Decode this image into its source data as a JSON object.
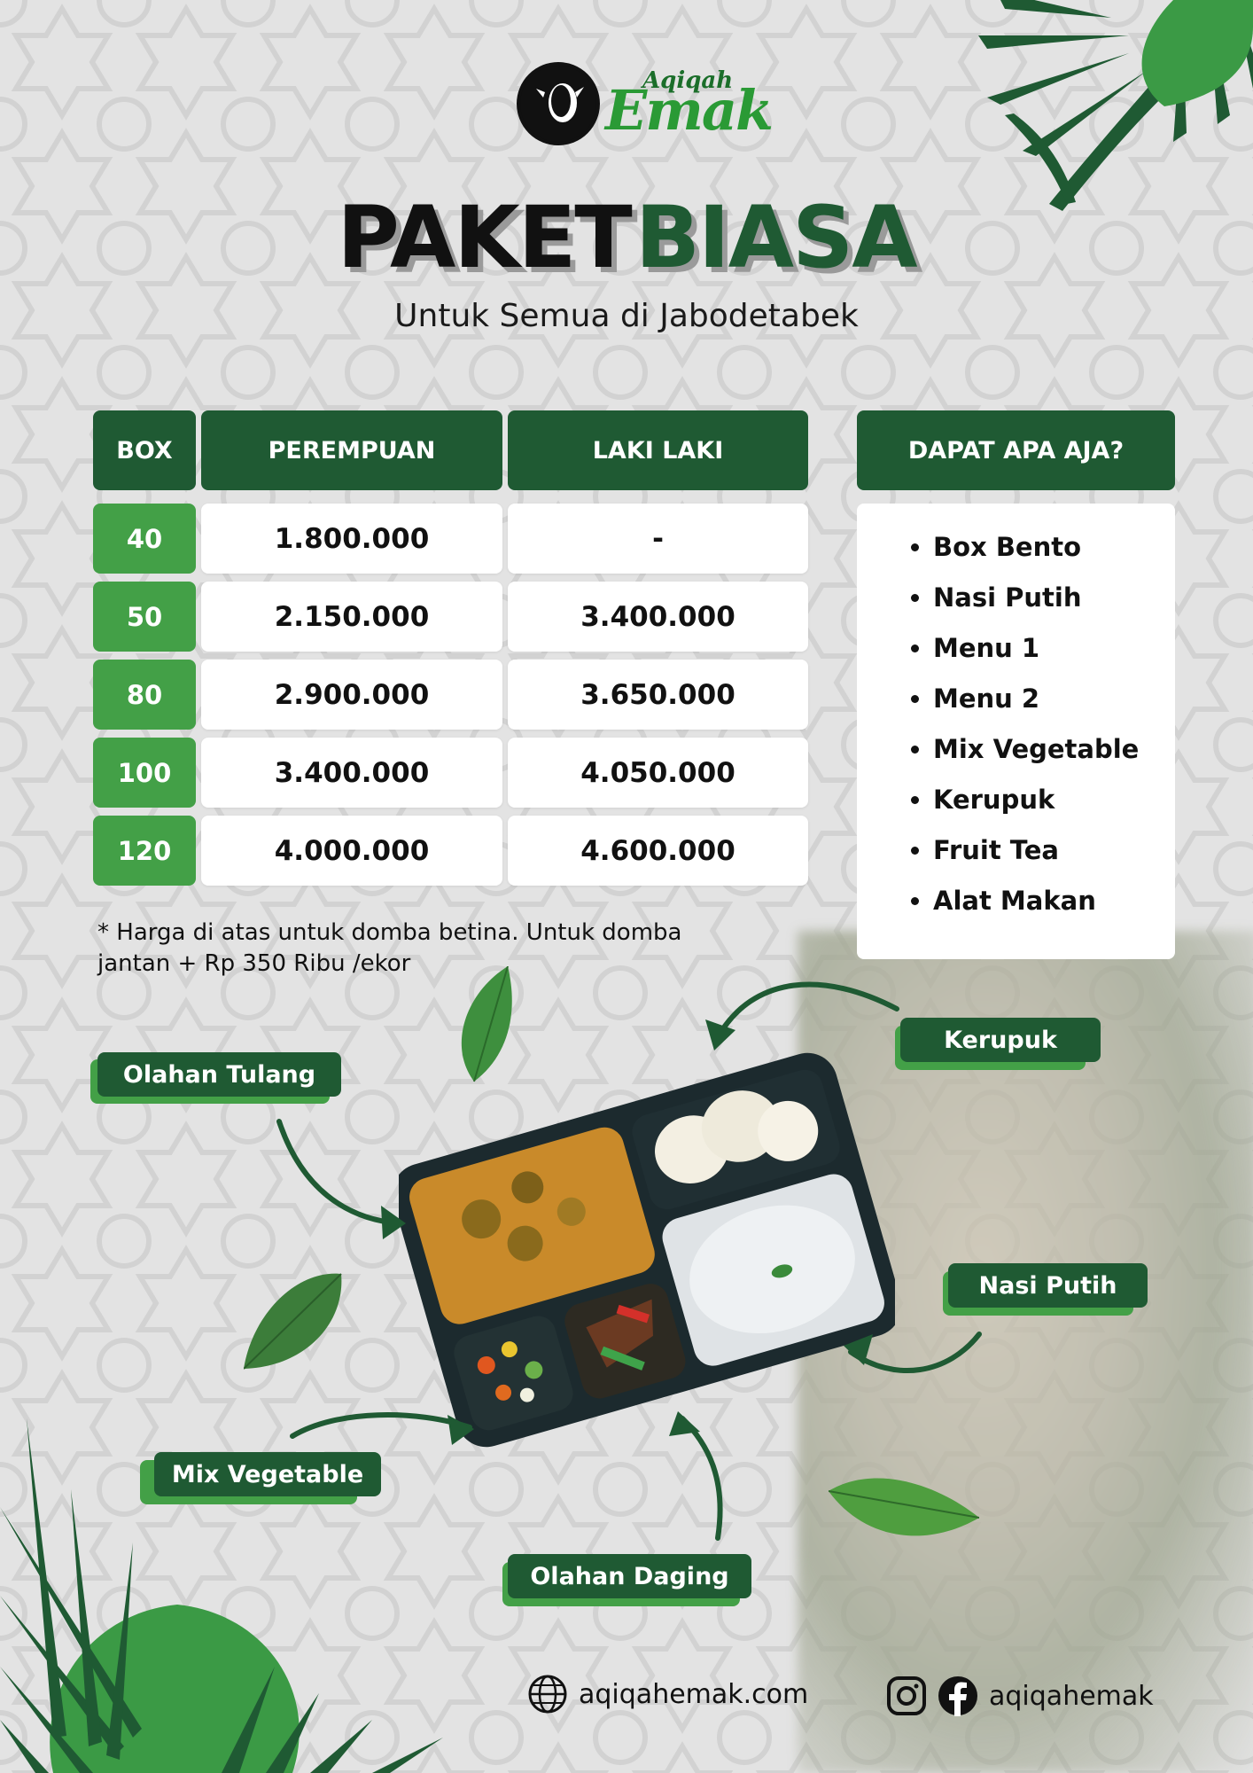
{
  "brand": {
    "line1": "Aqiqah",
    "line2": "Emak"
  },
  "title": {
    "word1": "PAKET",
    "word2": "BIASA"
  },
  "subtitle": "Untuk Semua di Jabodetabek",
  "price_table": {
    "headers": [
      "BOX",
      "PEREMPUAN",
      "LAKI LAKI"
    ],
    "rows": [
      {
        "box": "40",
        "perempuan": "1.800.000",
        "laki": "-"
      },
      {
        "box": "50",
        "perempuan": "2.150.000",
        "laki": "3.400.000"
      },
      {
        "box": "80",
        "perempuan": "2.900.000",
        "laki": "3.650.000"
      },
      {
        "box": "100",
        "perempuan": "3.400.000",
        "laki": "4.050.000"
      },
      {
        "box": "120",
        "perempuan": "4.000.000",
        "laki": "4.600.000"
      }
    ]
  },
  "included": {
    "header": "DAPAT APA AJA?",
    "items": [
      "Box Bento",
      "Nasi Putih",
      "Menu 1",
      "Menu 2",
      "Mix Vegetable",
      "Kerupuk",
      "Fruit Tea",
      "Alat Makan"
    ]
  },
  "note": "* Harga di atas untuk domba betina. Untuk domba jantan + Rp 350 Ribu /ekor",
  "food_labels": {
    "olahan_tulang": "Olahan Tulang",
    "kerupuk": "Kerupuk",
    "nasi_putih": "Nasi Putih",
    "mix_vegetable": "Mix Vegetable",
    "olahan_daging": "Olahan Daging"
  },
  "footer": {
    "website": "aqiqahemak.com",
    "social_handle": "aqiqahemak"
  },
  "colors": {
    "dark_green": "#1f5a33",
    "light_green": "#43a047",
    "background": "#e3e3e3"
  },
  "icons": [
    "globe-icon",
    "instagram-icon",
    "facebook-icon",
    "sheep-logo-icon"
  ]
}
